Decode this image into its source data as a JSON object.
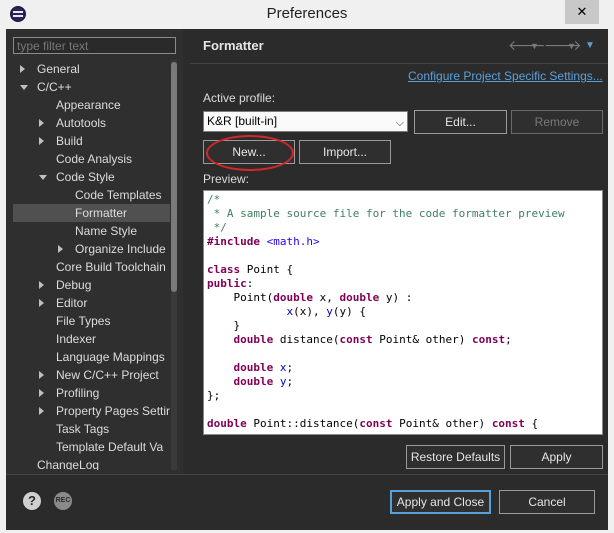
{
  "window": {
    "title": "Preferences",
    "close_glyph": "✕"
  },
  "filter": {
    "placeholder": "type filter text"
  },
  "tree": [
    {
      "label": "General",
      "depth": 0,
      "twisty": "closed"
    },
    {
      "label": "C/C++",
      "depth": 0,
      "twisty": "open"
    },
    {
      "label": "Appearance",
      "depth": 1,
      "twisty": "none"
    },
    {
      "label": "Autotools",
      "depth": 1,
      "twisty": "closed"
    },
    {
      "label": "Build",
      "depth": 1,
      "twisty": "closed"
    },
    {
      "label": "Code Analysis",
      "depth": 1,
      "twisty": "none"
    },
    {
      "label": "Code Style",
      "depth": 1,
      "twisty": "open"
    },
    {
      "label": "Code Templates",
      "depth": 2,
      "twisty": "none"
    },
    {
      "label": "Formatter",
      "depth": 2,
      "twisty": "none",
      "selected": true
    },
    {
      "label": "Name Style",
      "depth": 2,
      "twisty": "none"
    },
    {
      "label": "Organize Include",
      "depth": 2,
      "twisty": "closed"
    },
    {
      "label": "Core Build Toolchain",
      "depth": 1,
      "twisty": "none"
    },
    {
      "label": "Debug",
      "depth": 1,
      "twisty": "closed"
    },
    {
      "label": "Editor",
      "depth": 1,
      "twisty": "closed"
    },
    {
      "label": "File Types",
      "depth": 1,
      "twisty": "none"
    },
    {
      "label": "Indexer",
      "depth": 1,
      "twisty": "none"
    },
    {
      "label": "Language Mappings",
      "depth": 1,
      "twisty": "none"
    },
    {
      "label": "New C/C++ Project",
      "depth": 1,
      "twisty": "closed"
    },
    {
      "label": "Profiling",
      "depth": 1,
      "twisty": "closed"
    },
    {
      "label": "Property Pages Settir",
      "depth": 1,
      "twisty": "closed"
    },
    {
      "label": "Task Tags",
      "depth": 1,
      "twisty": "none"
    },
    {
      "label": "Template Default Va",
      "depth": 1,
      "twisty": "none"
    },
    {
      "label": "ChangeLog",
      "depth": 0,
      "twisty": "none"
    }
  ],
  "page": {
    "title": "Formatter",
    "configure_link": "Configure Project Specific Settings...",
    "active_profile_label": "Active profile:",
    "profile_value": "K&R [built-in]",
    "edit_button": "Edit...",
    "remove_button": "Remove",
    "new_button": "New...",
    "import_button": "Import...",
    "preview_label": "Preview:",
    "restore_defaults_button": "Restore Defaults",
    "apply_button": "Apply"
  },
  "nav": {
    "back_icon": "back-arrow-icon",
    "forward_icon": "forward-arrow-icon",
    "menu_icon": "view-menu-icon"
  },
  "code_lines": [
    [
      [
        "c",
        "/*"
      ]
    ],
    [
      [
        "c",
        " * A sample source file for the code formatter preview"
      ]
    ],
    [
      [
        "c",
        " */"
      ]
    ],
    [
      [
        "p",
        "#include "
      ],
      [
        "s",
        "<math.h>"
      ]
    ],
    [],
    [
      [
        "k",
        "class"
      ],
      [
        "t",
        " Point {"
      ]
    ],
    [
      [
        "k",
        "public"
      ],
      [
        "t",
        ":"
      ]
    ],
    [
      [
        "t",
        "    Point("
      ],
      [
        "k",
        "double"
      ],
      [
        "t",
        " x, "
      ],
      [
        "k",
        "double"
      ],
      [
        "t",
        " y) :"
      ]
    ],
    [
      [
        "t",
        "            "
      ],
      [
        "f",
        "x"
      ],
      [
        "t",
        "(x), "
      ],
      [
        "f",
        "y"
      ],
      [
        "t",
        "(y) {"
      ]
    ],
    [
      [
        "t",
        "    }"
      ]
    ],
    [
      [
        "t",
        "    "
      ],
      [
        "k",
        "double"
      ],
      [
        "t",
        " distance("
      ],
      [
        "k",
        "const"
      ],
      [
        "t",
        " Point& other) "
      ],
      [
        "k",
        "const"
      ],
      [
        "t",
        ";"
      ]
    ],
    [],
    [
      [
        "t",
        "    "
      ],
      [
        "k",
        "double"
      ],
      [
        "t",
        " "
      ],
      [
        "f",
        "x"
      ],
      [
        "t",
        ";"
      ]
    ],
    [
      [
        "t",
        "    "
      ],
      [
        "k",
        "double"
      ],
      [
        "t",
        " "
      ],
      [
        "f",
        "y"
      ],
      [
        "t",
        ";"
      ]
    ],
    [
      [
        "t",
        "};"
      ]
    ],
    [],
    [
      [
        "k",
        "double"
      ],
      [
        "t",
        " Point::distance("
      ],
      [
        "k",
        "const"
      ],
      [
        "t",
        " Point& other) "
      ],
      [
        "k",
        "const"
      ],
      [
        "t",
        " {"
      ]
    ]
  ],
  "footer": {
    "help_glyph": "?",
    "rec_glyph": "REC",
    "apply_close_button": "Apply and Close",
    "cancel_button": "Cancel"
  }
}
